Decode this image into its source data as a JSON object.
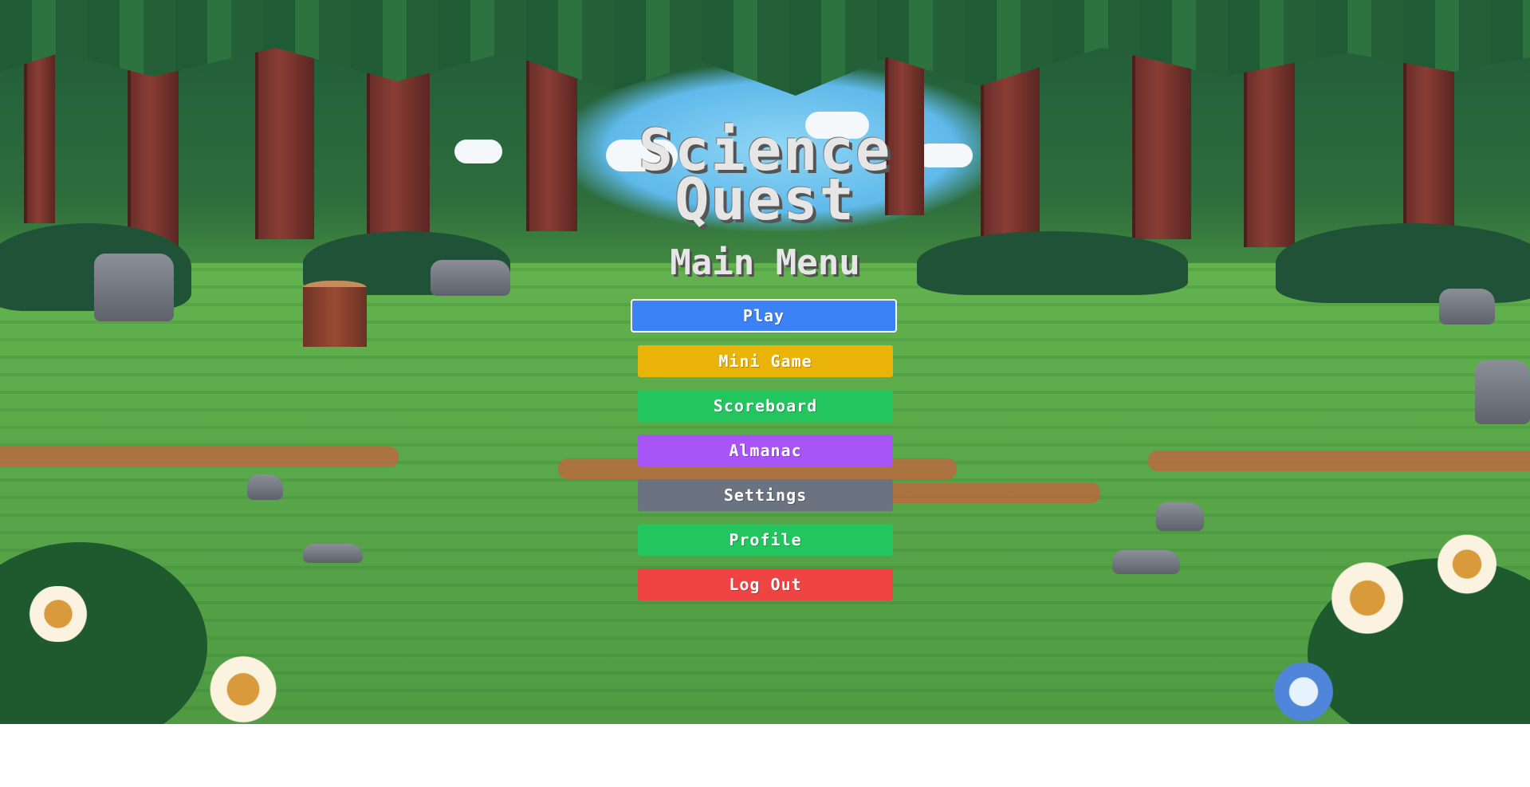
{
  "game": {
    "title_line1": "Science",
    "title_line2": "Quest",
    "menu_heading": "Main Menu"
  },
  "menu": {
    "buttons": [
      {
        "label": "Play",
        "color": "#3b82f6",
        "selected": true
      },
      {
        "label": "Mini Game",
        "color": "#eab308"
      },
      {
        "label": "Scoreboard",
        "color": "#22c55e"
      },
      {
        "label": "Almanac",
        "color": "#a855f7"
      },
      {
        "label": "Settings",
        "color": "#6b7280"
      },
      {
        "label": "Profile",
        "color": "#22c55e"
      },
      {
        "label": "Log Out",
        "color": "#ef4444"
      }
    ]
  },
  "background": {
    "theme": "pixel-art forest clearing"
  }
}
